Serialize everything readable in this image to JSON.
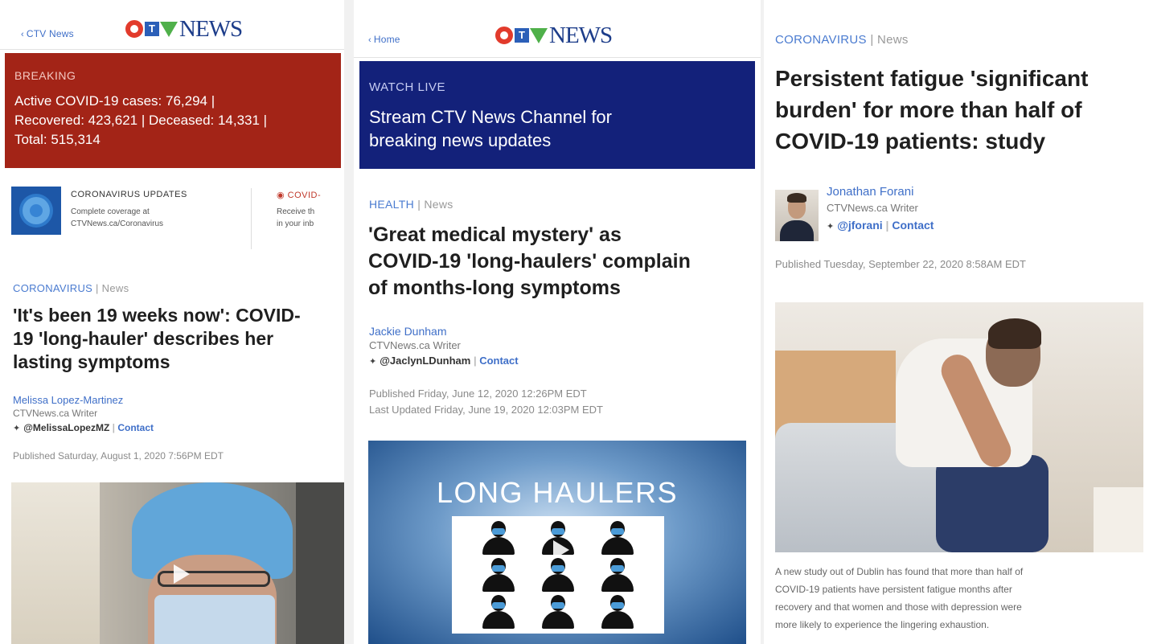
{
  "brand": {
    "logo_word": "NEWS",
    "logo_letter": "T"
  },
  "panel1": {
    "back_label": "CTV News",
    "breaking": {
      "kicker": "BREAKING",
      "lines": [
        "Active COVID-19 cases: 76,294 |",
        "Recovered: 423,621 | Deceased: 14,331 |",
        "Total: 515,314"
      ]
    },
    "promo": {
      "title": "CORONAVIRUS UPDATES",
      "desc_line1": "Complete coverage at",
      "desc_line2": "CTVNews.ca/Coronavirus",
      "title2": "COVID-",
      "desc2_line1": "Receive th",
      "desc2_line2": "in your inb"
    },
    "section": "CORONAVIRUS",
    "section_suffix": "News",
    "headline_lines": [
      "'It's been 19 weeks now': COVID-",
      "19 'long-hauler' describes her",
      "lasting symptoms"
    ],
    "author": "Melissa Lopez-Martinez",
    "role": "CTVNews.ca Writer",
    "handle": "@MelissaLopezMZ",
    "contact": "Contact",
    "published": "Published Saturday, August 1, 2020 7:56PM EDT"
  },
  "panel2": {
    "back_label": "Home",
    "live": {
      "kicker": "WATCH LIVE",
      "line1": "Stream CTV News Channel for",
      "line2": "breaking news updates"
    },
    "section": "HEALTH",
    "section_suffix": "News",
    "headline_lines": [
      "'Great medical mystery' as",
      "COVID-19 'long-haulers' complain",
      "of months-long symptoms"
    ],
    "author": "Jackie Dunham",
    "role": "CTVNews.ca Writer",
    "handle": "@JaclynLDunham",
    "contact": "Contact",
    "published": "Published Friday, June 12, 2020 12:26PM EDT",
    "updated": "Last Updated Friday, June 19, 2020 12:03PM EDT",
    "image_title": "LONG HAULERS"
  },
  "panel3": {
    "section": "CORONAVIRUS",
    "section_suffix": "News",
    "headline_lines": [
      "Persistent fatigue 'significant",
      "burden' for more than half of",
      "COVID-19 patients: study"
    ],
    "author": "Jonathan Forani",
    "role": "CTVNews.ca Writer",
    "handle": "@jforani",
    "contact": "Contact",
    "published": "Published Tuesday, September 22, 2020 8:58AM EDT",
    "caption_lines": [
      "A new study out of Dublin has found that more than half of",
      "COVID-19 patients have persistent fatigue months after",
      "recovery and that women and those with depression were",
      "more likely to experience the lingering exhaustion."
    ]
  }
}
